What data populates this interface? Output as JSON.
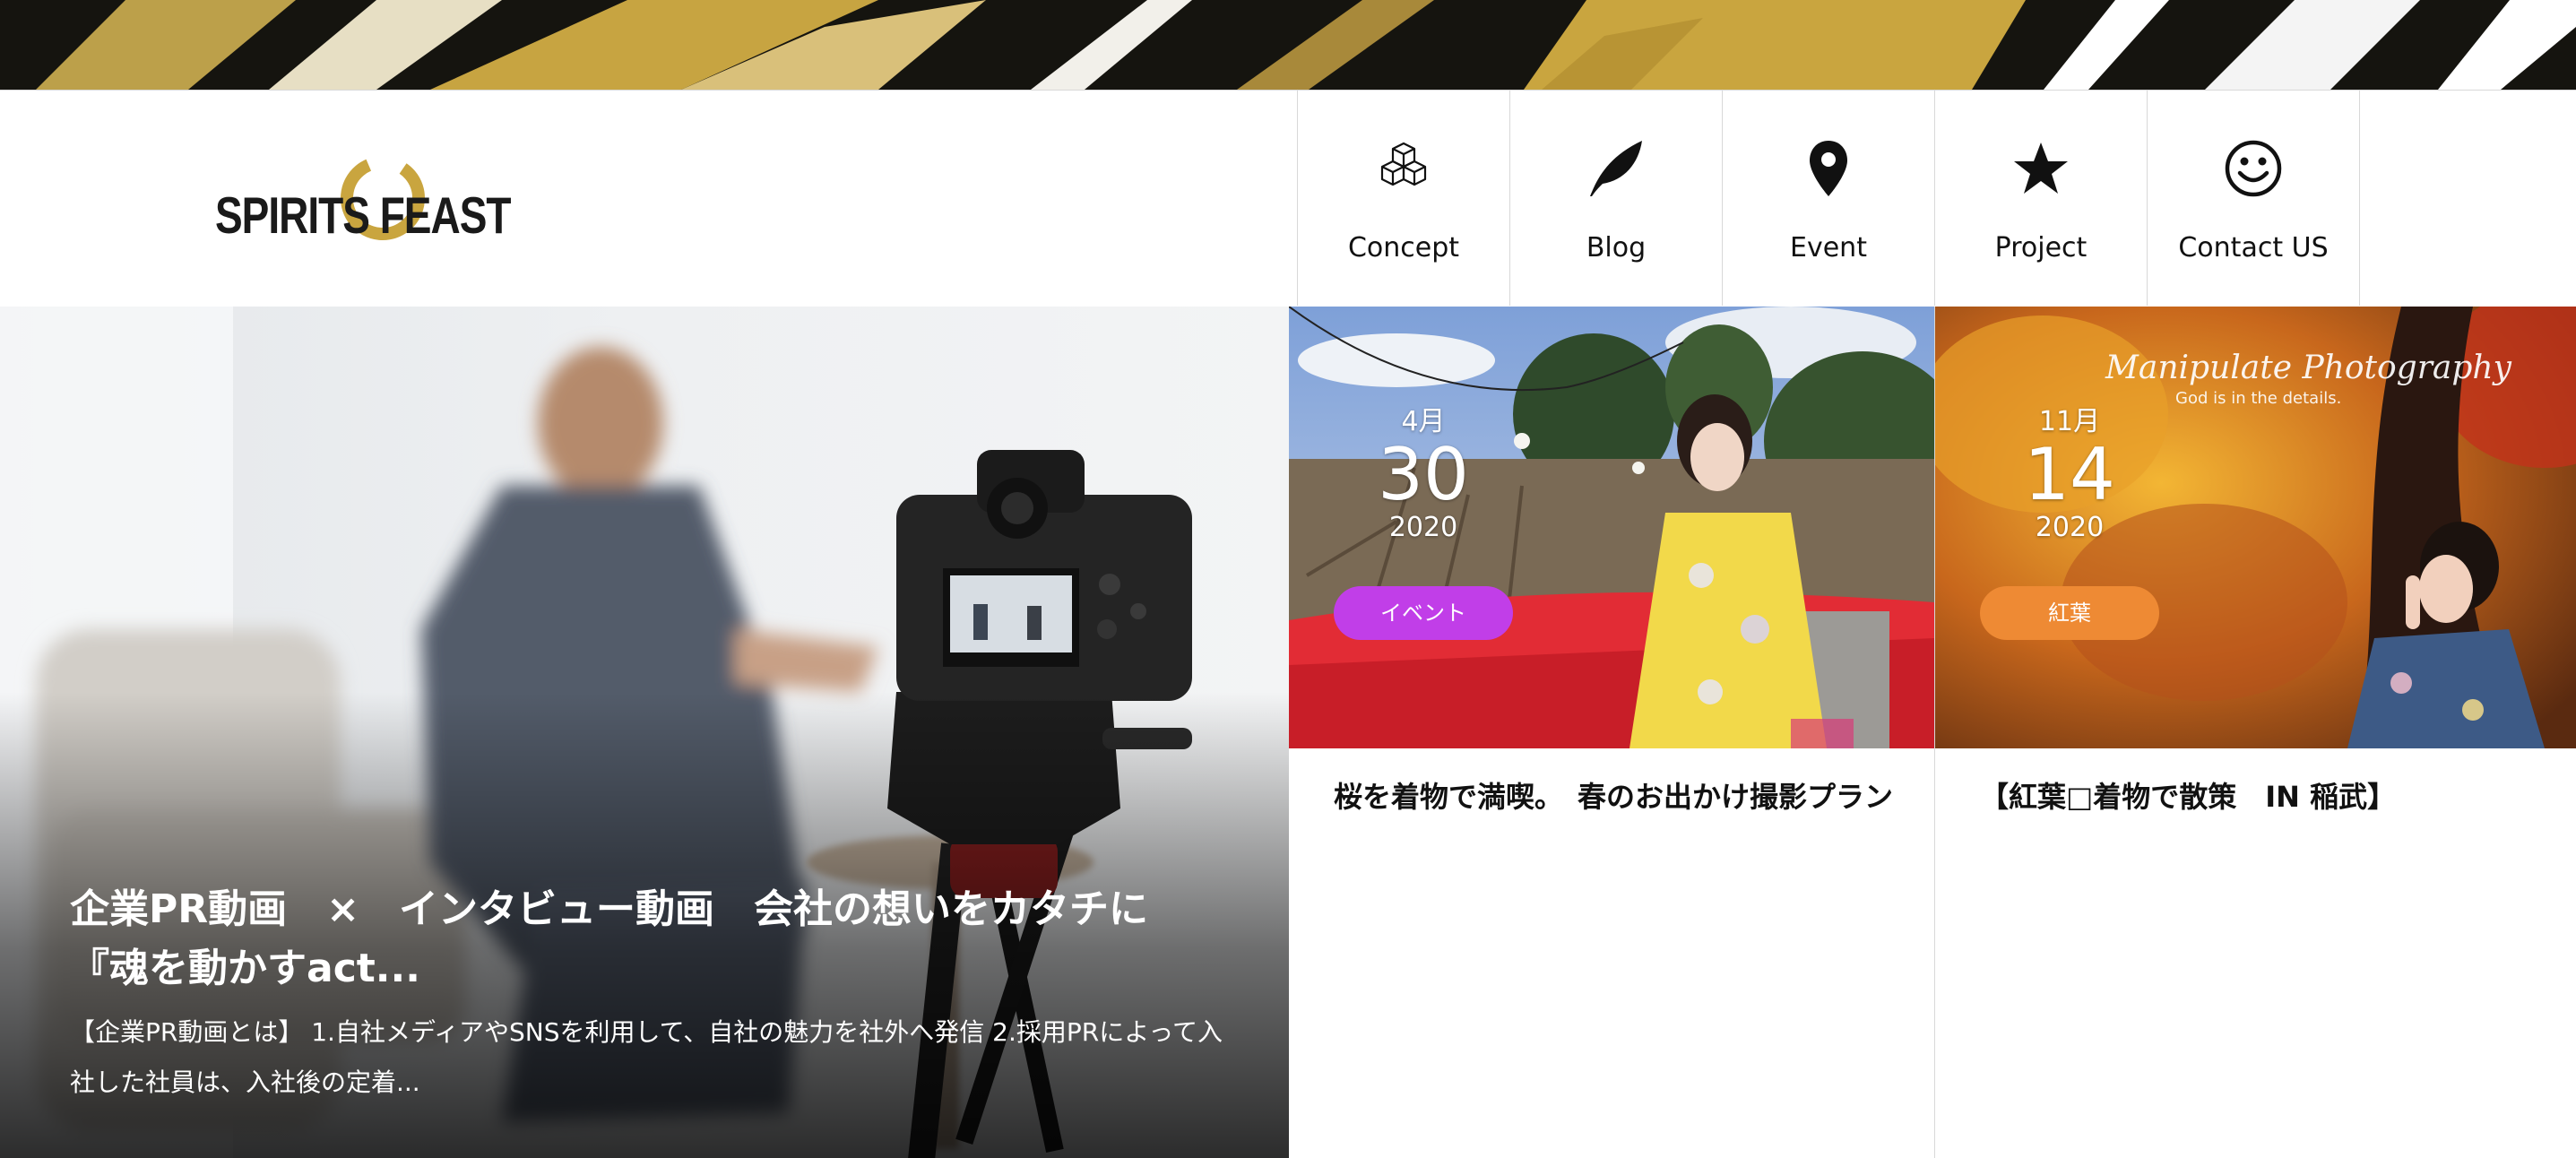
{
  "header": {
    "logo_text": "SPIRITS FEAST",
    "nav": [
      {
        "label": "Concept",
        "icon": "cubes-icon"
      },
      {
        "label": "Blog",
        "icon": "feather-icon"
      },
      {
        "label": "Event",
        "icon": "map-pin-icon"
      },
      {
        "label": "Project",
        "icon": "star-icon"
      },
      {
        "label": "Contact US",
        "icon": "smiley-icon"
      }
    ]
  },
  "hero": {
    "title": "企業PR動画　×　インタビュー動画　会社の想いをカタチに　　　『魂を動かすact...",
    "excerpt": "【企業PR動画とは】 1.自社メディアやSNSを利用して、自社の魅力を社外へ発信 2.採用PRによって入社した社員は、入社後の定着..."
  },
  "cards": [
    {
      "month": "4月",
      "day": "30",
      "year": "2020",
      "badge": "イベント",
      "badge_color": "#c13ee8",
      "title": "桜を着物で満喫。　春のお出かけ撮影プラン"
    },
    {
      "month": "11月",
      "day": "14",
      "year": "2020",
      "badge": "紅葉",
      "badge_color": "#ee8a34",
      "title": "【紅葉□着物で散策　IN 稲武】",
      "watermark_title": "Manipulate Photography",
      "watermark_sub": "God is in the details."
    }
  ],
  "colors": {
    "brand_gold": "#c9a53f",
    "border": "#d8d8d8"
  }
}
